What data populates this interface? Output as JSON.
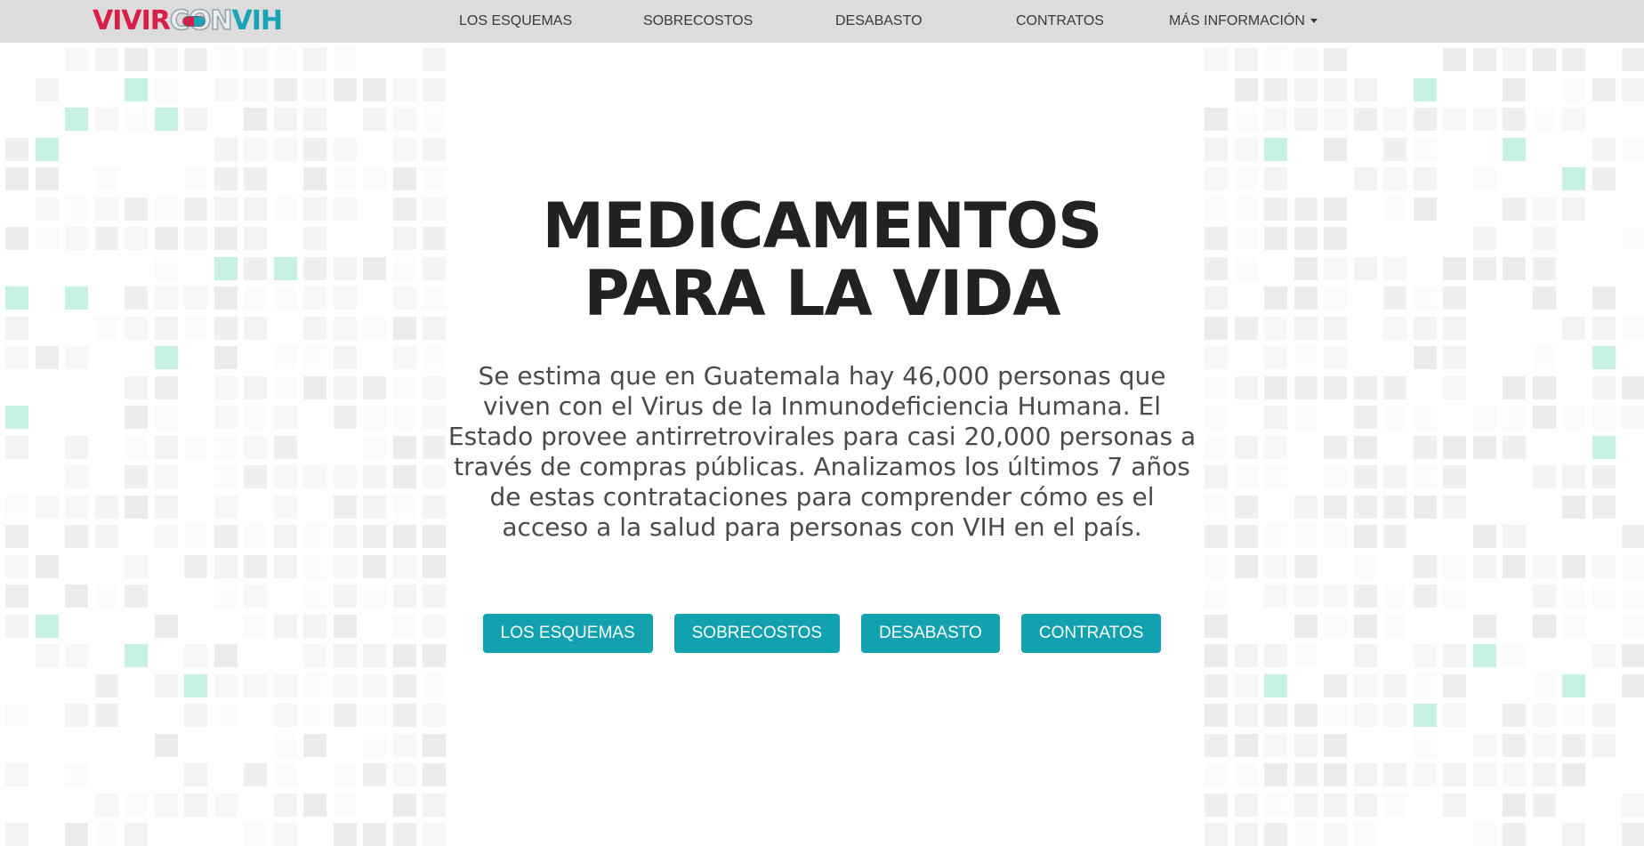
{
  "navbar": {
    "logo": {
      "part1": "VIVIR",
      "part2": "CON",
      "part3": "VIH"
    },
    "links": [
      "LOS ESQUEMAS",
      "SOBRECOSTOS",
      "DESABASTO",
      "CONTRATOS"
    ],
    "more_label": "MÁS INFORMACIÓN",
    "more_icon": "caret-down-icon"
  },
  "hero": {
    "title_line1": "MEDICAMENTOS",
    "title_line2": "PARA LA VIDA",
    "paragraph": "Se estima que en Guatemala hay 46,000 personas que viven con el Virus de la Inmunodeficiencia Humana. El Estado provee antirretrovirales para casi 20,000 personas a través de compras públicas. Analizamos los últimos 7 años de estas contrataciones para comprender cómo es el acceso a la salud para personas con VIH en el país.",
    "buttons": [
      "LOS ESQUEMAS",
      "SOBRECOSTOS",
      "DESABASTO",
      "CONTRATOS"
    ]
  },
  "colors": {
    "navbar_bg": "#dcdcdc",
    "brand_red": "#d91e48",
    "brand_teal": "#19a4b5",
    "button_bg": "#12a1ae",
    "title_text": "#222222",
    "body_text": "#4a4a4a",
    "grid_accent": "#c8f1e6"
  }
}
